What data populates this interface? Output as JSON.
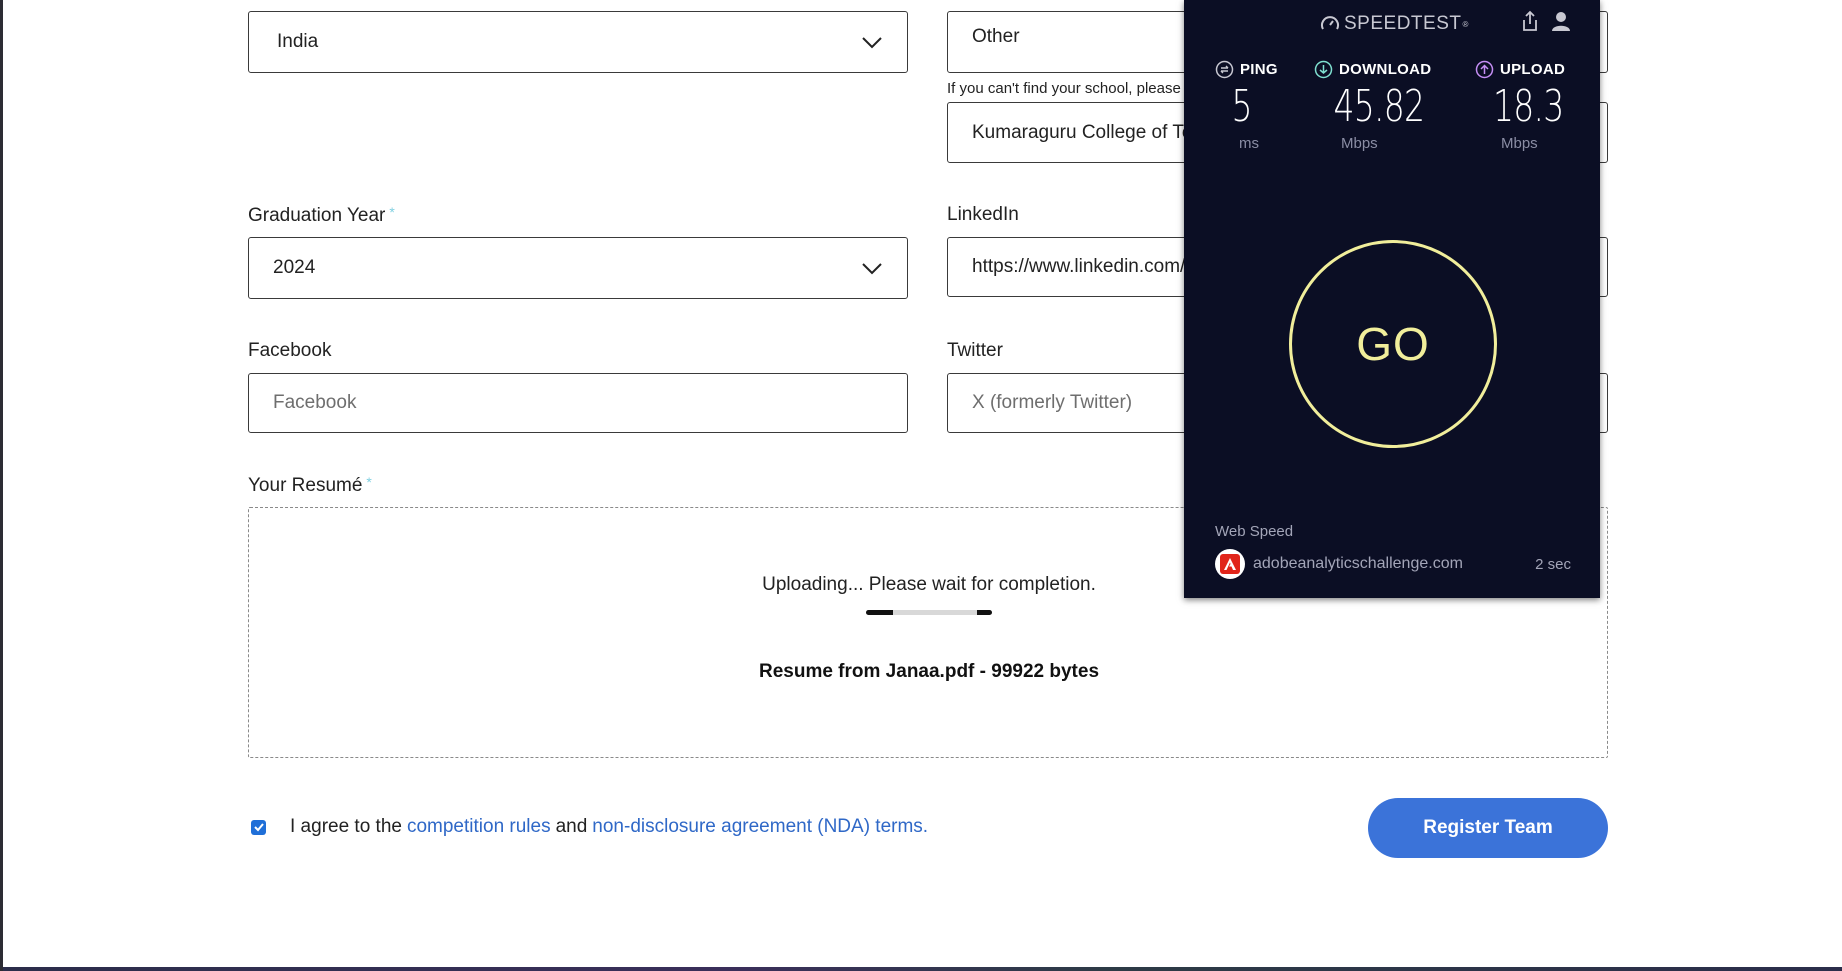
{
  "form": {
    "country": {
      "value": "India"
    },
    "school": {
      "value": "Other"
    },
    "school_hint": "If you can't find your school, please",
    "school_name": {
      "value": "Kumaraguru College of Tec"
    },
    "graduation_year": {
      "label": "Graduation Year",
      "required_mark": "*",
      "value": "2024"
    },
    "linkedin": {
      "label": "LinkedIn",
      "value": "https://www.linkedin.com/"
    },
    "facebook": {
      "label": "Facebook",
      "placeholder": "Facebook"
    },
    "twitter": {
      "label": "Twitter",
      "placeholder": "X (formerly Twitter)"
    },
    "resume": {
      "label": "Your Resumé",
      "required_mark": "*",
      "status": "Uploading... Please wait for completion.",
      "file_info": "Resume from Janaa.pdf - 99922 bytes"
    },
    "agree": {
      "checked": true,
      "prefix": "I agree to the",
      "rules_link": "competition rules",
      "and": "and",
      "nda_link": "non-disclosure agreement (NDA) terms."
    },
    "register_button": "Register Team"
  },
  "speedtest": {
    "brand": "SPEEDTEST",
    "registered": "®",
    "ping": {
      "label": "PING",
      "value": "5",
      "unit": "ms"
    },
    "download": {
      "label": "DOWNLOAD",
      "value": "45.82",
      "unit": "Mbps"
    },
    "upload": {
      "label": "UPLOAD",
      "value": "18.3",
      "unit": "Mbps"
    },
    "go_label": "GO",
    "web_speed_label": "Web Speed",
    "site": "adobeanalyticschallenge.com",
    "site_time": "2 sec"
  },
  "colors": {
    "accent_blue": "#3b73d9",
    "link_blue": "#2f68c7",
    "speedtest_bg": "#0b0e24",
    "go_yellow": "#f1ee9b"
  }
}
